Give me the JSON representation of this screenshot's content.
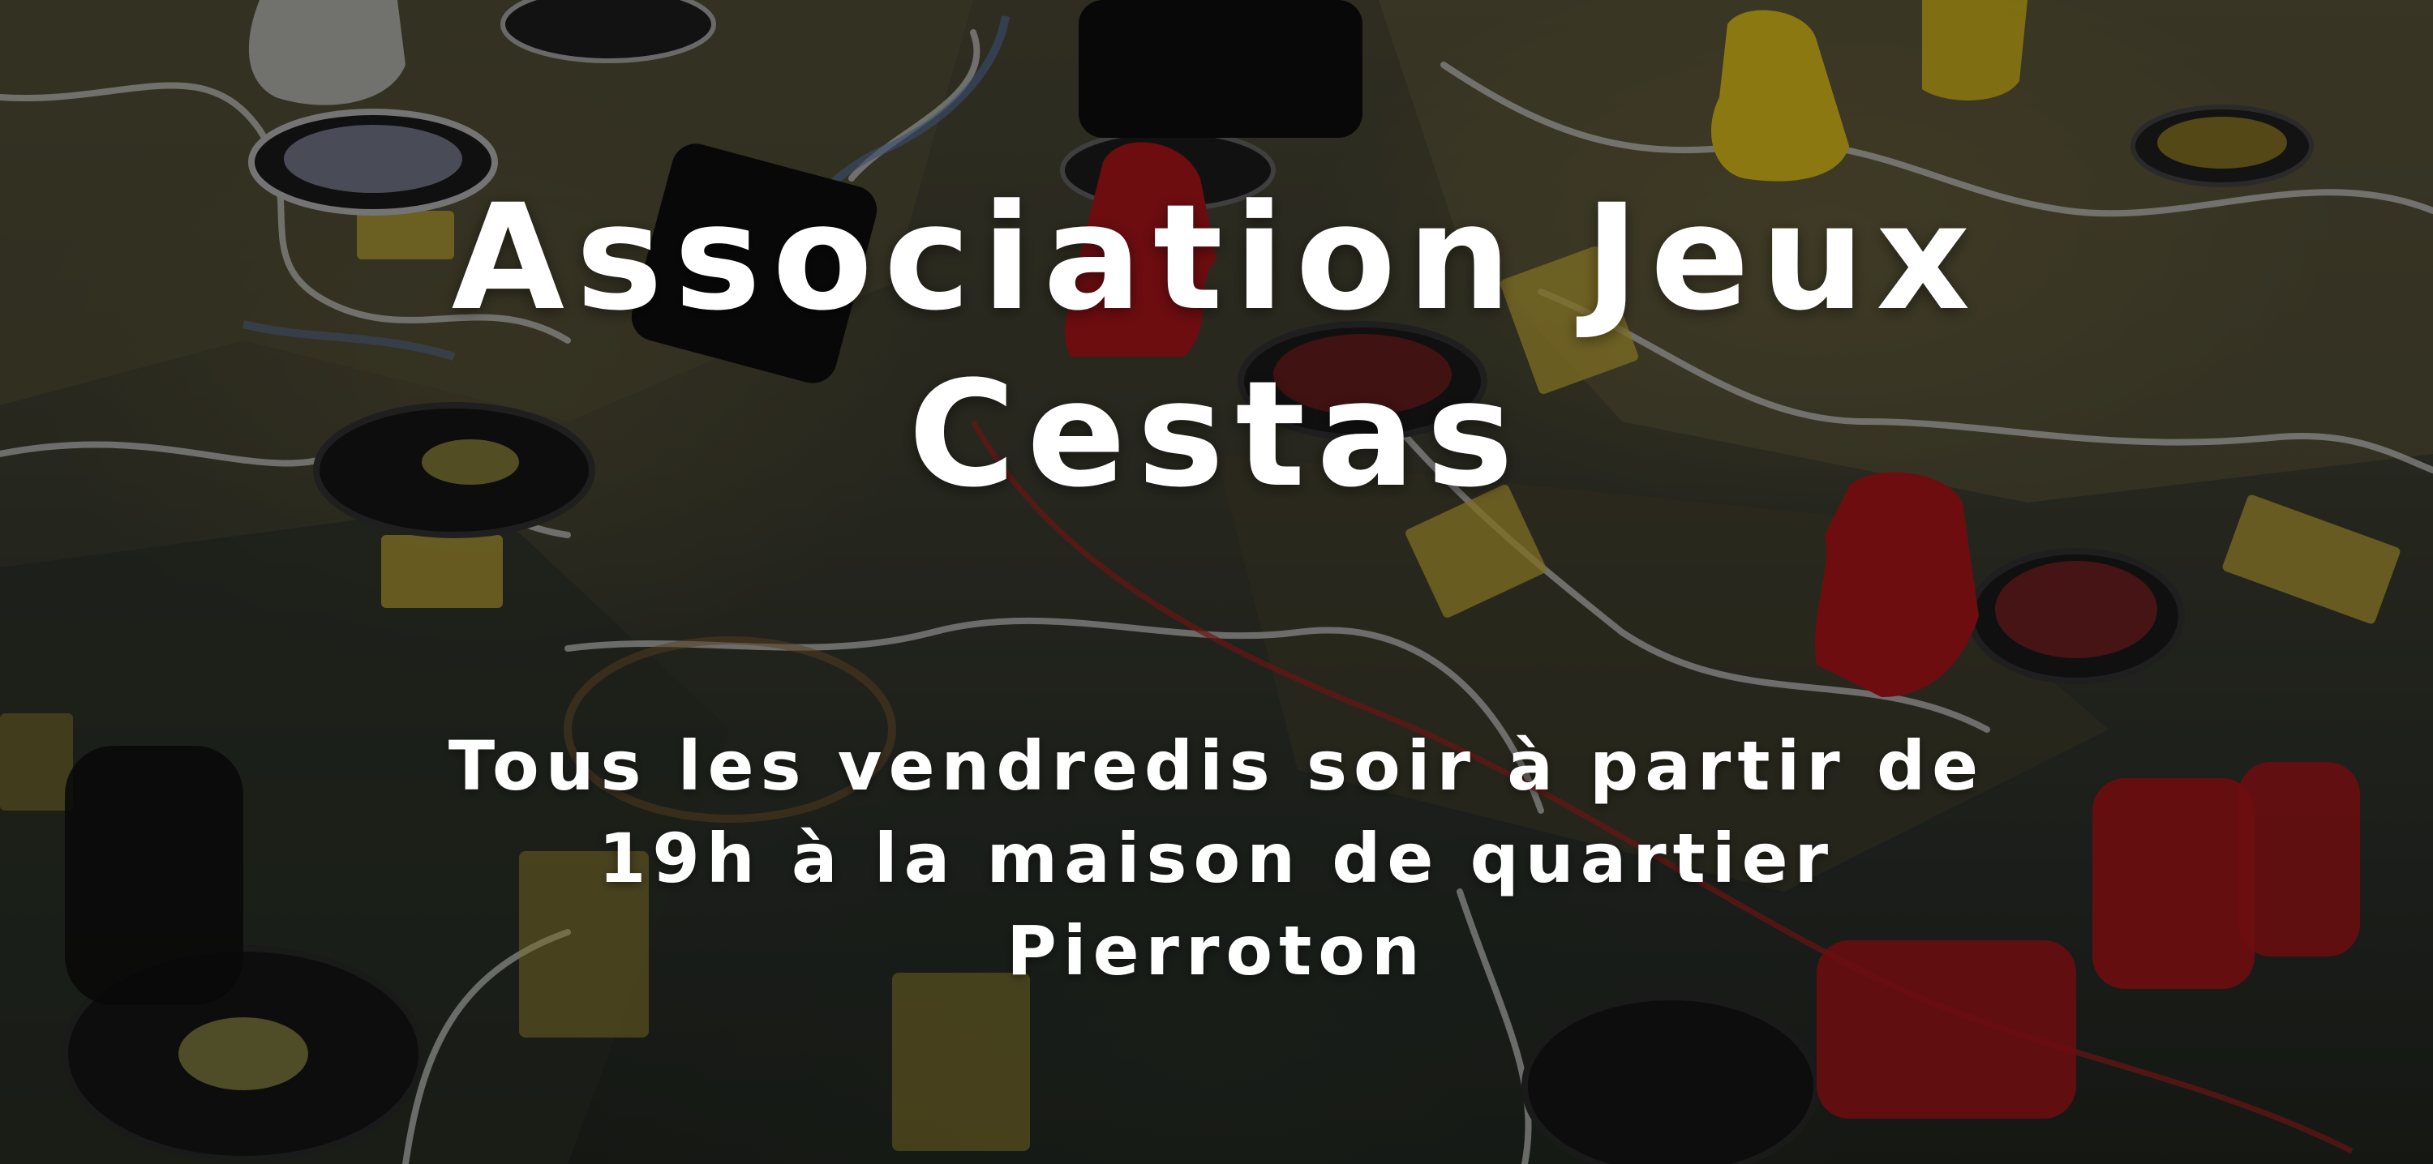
{
  "hero": {
    "title_lines": [
      "Association Jeux",
      "Cestas"
    ],
    "subtitle_lines": [
      "Tous les vendredis soir à partir de",
      "19h à la maison de quartier",
      "Pierroton"
    ]
  },
  "colors": {
    "text": "#ffffff",
    "overlay": "rgba(0,0,0,0.38)",
    "board_dark": "#22261f",
    "board_mid": "#3e3f31",
    "piece_red": "#b0151a",
    "piece_yellow": "#e0c21a",
    "piece_black": "#111111",
    "border_white": "#d8d8d8"
  },
  "background": {
    "description_icon": "board-game-map-image"
  }
}
